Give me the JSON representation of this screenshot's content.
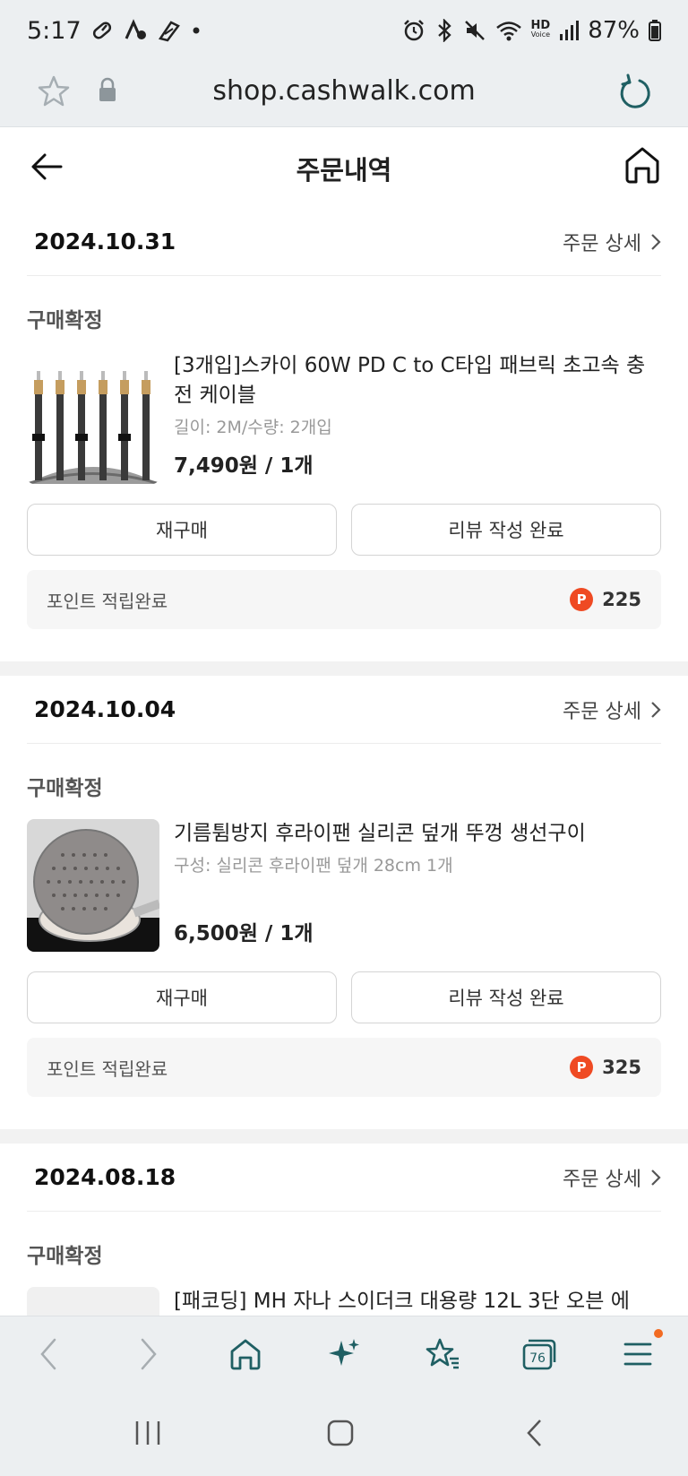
{
  "status_bar": {
    "time": "5:17",
    "left_icons": [
      "pill-icon",
      "a-c-notification-icon",
      "sale-notification-icon",
      "dot-icon"
    ],
    "right_icons": [
      "alarm-icon",
      "bluetooth-icon",
      "mute-icon",
      "wifi-icon",
      "hd-voice-icon",
      "signal-icon"
    ],
    "hd_label": "HD",
    "voice_label": "Voice",
    "battery": "87%"
  },
  "browser": {
    "url": "shop.cashwalk.com",
    "tab_count": "76"
  },
  "page": {
    "title": "주문내역"
  },
  "orders": [
    {
      "date": "2024.10.31",
      "detail_label": "주문 상세",
      "status": "구매확정",
      "product_name": "[3개입]스카이 60W PD C to C타입 패브릭 초고속 충전 케이블",
      "option": "길이: 2M/수량: 2개입",
      "price": "7,490원 / 1개",
      "rebuy_label": "재구매",
      "review_label": "리뷰 작성 완료",
      "points_label": "포인트 적립완료",
      "points_badge": "P",
      "points_value": "225"
    },
    {
      "date": "2024.10.04",
      "detail_label": "주문 상세",
      "status": "구매확정",
      "product_name": "기름튐방지 후라이팬 실리콘 덮개 뚜껑 생선구이",
      "option": "구성: 실리콘 후라이팬 덮개 28cm 1개",
      "price": "6,500원 / 1개",
      "rebuy_label": "재구매",
      "review_label": "리뷰 작성 완료",
      "points_label": "포인트 적립완료",
      "points_badge": "P",
      "points_value": "325"
    },
    {
      "date": "2024.08.18",
      "detail_label": "주문 상세",
      "status": "구매확정",
      "product_name_partial": "[패코딩] MH 자나 스이더크 대용량 12L 3단 오븐 에"
    }
  ],
  "colors": {
    "chrome_bg": "#eceff1",
    "accent_teal": "#1f5f63",
    "points_badge": "#ef4a23",
    "notification_dot": "#f26b22"
  }
}
